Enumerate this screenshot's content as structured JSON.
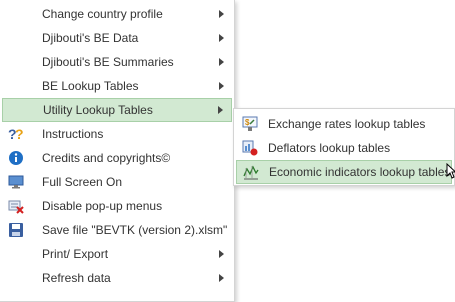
{
  "main_menu": {
    "items": [
      {
        "label": "Change country profile",
        "icon": "",
        "has_submenu": true
      },
      {
        "label": "Djibouti's BE Data",
        "icon": "",
        "has_submenu": true
      },
      {
        "label": "Djibouti's BE Summaries",
        "icon": "",
        "has_submenu": true
      },
      {
        "label": "BE Lookup Tables",
        "icon": "",
        "has_submenu": true
      },
      {
        "label": "Utility Lookup Tables",
        "icon": "",
        "has_submenu": true,
        "highlighted": true
      },
      {
        "label": "Instructions",
        "icon": "help-icon",
        "has_submenu": false
      },
      {
        "label": "Credits and copyrights©",
        "icon": "info-icon",
        "has_submenu": false
      },
      {
        "label": "Full Screen On",
        "icon": "fullscreen-icon",
        "has_submenu": false
      },
      {
        "label": "Disable pop-up menus",
        "icon": "disable-menu-icon",
        "has_submenu": false
      },
      {
        "label": "Save file \"BEVTK (version 2).xlsm\"",
        "icon": "save-icon",
        "has_submenu": false
      },
      {
        "label": "Print/ Export",
        "icon": "",
        "has_submenu": true
      },
      {
        "label": "Refresh data",
        "icon": "",
        "has_submenu": true
      }
    ]
  },
  "sub_menu": {
    "items": [
      {
        "label": "Exchange rates lookup tables",
        "icon": "exchange-rate-icon"
      },
      {
        "label": "Deflators lookup tables",
        "icon": "deflator-icon"
      },
      {
        "label": "Economic indicators lookup tables",
        "icon": "economic-indicators-icon",
        "highlighted": true
      }
    ]
  },
  "colors": {
    "highlight_bg": "#d2e9d2",
    "highlight_border": "#a8d0a8",
    "text": "#333333"
  }
}
